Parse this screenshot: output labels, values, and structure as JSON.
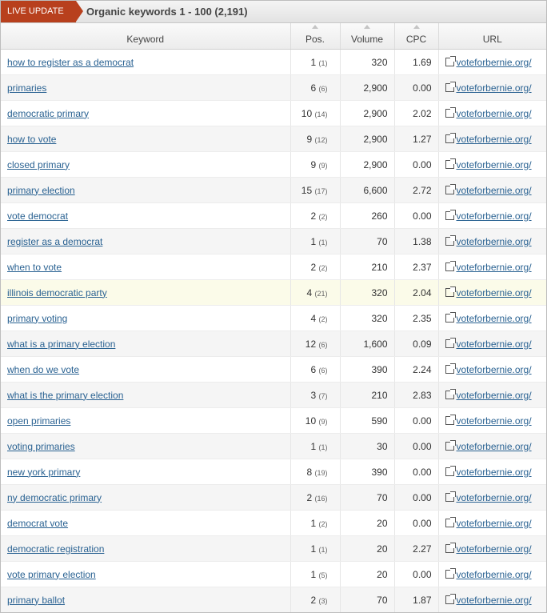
{
  "header": {
    "live_label": "LIVE UPDATE",
    "title": "Organic keywords 1 - 100 (2,191)"
  },
  "columns": {
    "keyword": "Keyword",
    "pos": "Pos.",
    "volume": "Volume",
    "cpc": "CPC",
    "url": "URL"
  },
  "rows": [
    {
      "keyword": "how to register as a democrat",
      "pos": "1",
      "prev": "(1)",
      "volume": "320",
      "cpc": "1.69",
      "url": "voteforbernie.org/"
    },
    {
      "keyword": "primaries",
      "pos": "6",
      "prev": "(6)",
      "volume": "2,900",
      "cpc": "0.00",
      "url": "voteforbernie.org/"
    },
    {
      "keyword": "democratic primary",
      "pos": "10",
      "prev": "(14)",
      "volume": "2,900",
      "cpc": "2.02",
      "url": "voteforbernie.org/"
    },
    {
      "keyword": "how to vote",
      "pos": "9",
      "prev": "(12)",
      "volume": "2,900",
      "cpc": "1.27",
      "url": "voteforbernie.org/"
    },
    {
      "keyword": "closed primary",
      "pos": "9",
      "prev": "(9)",
      "volume": "2,900",
      "cpc": "0.00",
      "url": "voteforbernie.org/"
    },
    {
      "keyword": "primary election",
      "pos": "15",
      "prev": "(17)",
      "volume": "6,600",
      "cpc": "2.72",
      "url": "voteforbernie.org/"
    },
    {
      "keyword": "vote democrat",
      "pos": "2",
      "prev": "(2)",
      "volume": "260",
      "cpc": "0.00",
      "url": "voteforbernie.org/"
    },
    {
      "keyword": "register as a democrat",
      "pos": "1",
      "prev": "(1)",
      "volume": "70",
      "cpc": "1.38",
      "url": "voteforbernie.org/"
    },
    {
      "keyword": "when to vote",
      "pos": "2",
      "prev": "(2)",
      "volume": "210",
      "cpc": "2.37",
      "url": "voteforbernie.org/"
    },
    {
      "keyword": "illinois democratic party",
      "pos": "4",
      "prev": "(21)",
      "volume": "320",
      "cpc": "2.04",
      "url": "voteforbernie.org/"
    },
    {
      "keyword": "primary voting",
      "pos": "4",
      "prev": "(2)",
      "volume": "320",
      "cpc": "2.35",
      "url": "voteforbernie.org/"
    },
    {
      "keyword": "what is a primary election",
      "pos": "12",
      "prev": "(6)",
      "volume": "1,600",
      "cpc": "0.09",
      "url": "voteforbernie.org/"
    },
    {
      "keyword": "when do we vote",
      "pos": "6",
      "prev": "(6)",
      "volume": "390",
      "cpc": "2.24",
      "url": "voteforbernie.org/"
    },
    {
      "keyword": "what is the primary election",
      "pos": "3",
      "prev": "(7)",
      "volume": "210",
      "cpc": "2.83",
      "url": "voteforbernie.org/"
    },
    {
      "keyword": "open primaries",
      "pos": "10",
      "prev": "(9)",
      "volume": "590",
      "cpc": "0.00",
      "url": "voteforbernie.org/"
    },
    {
      "keyword": "voting primaries",
      "pos": "1",
      "prev": "(1)",
      "volume": "30",
      "cpc": "0.00",
      "url": "voteforbernie.org/"
    },
    {
      "keyword": "new york primary",
      "pos": "8",
      "prev": "(19)",
      "volume": "390",
      "cpc": "0.00",
      "url": "voteforbernie.org/"
    },
    {
      "keyword": "ny democratic primary",
      "pos": "2",
      "prev": "(16)",
      "volume": "70",
      "cpc": "0.00",
      "url": "voteforbernie.org/"
    },
    {
      "keyword": "democrat vote",
      "pos": "1",
      "prev": "(2)",
      "volume": "20",
      "cpc": "0.00",
      "url": "voteforbernie.org/"
    },
    {
      "keyword": "democratic registration",
      "pos": "1",
      "prev": "(1)",
      "volume": "20",
      "cpc": "2.27",
      "url": "voteforbernie.org/"
    },
    {
      "keyword": "vote primary election",
      "pos": "1",
      "prev": "(5)",
      "volume": "20",
      "cpc": "0.00",
      "url": "voteforbernie.org/"
    },
    {
      "keyword": "primary ballot",
      "pos": "2",
      "prev": "(3)",
      "volume": "70",
      "cpc": "1.87",
      "url": "voteforbernie.org/"
    }
  ],
  "icons": {
    "url_link": "external-link-icon",
    "sort": "sort-arrow-icon"
  },
  "colors": {
    "live_badge": "#b8401d",
    "link": "#2a6292",
    "highlight_row": "#fbfbe9",
    "alt_row": "#f5f5f5"
  }
}
